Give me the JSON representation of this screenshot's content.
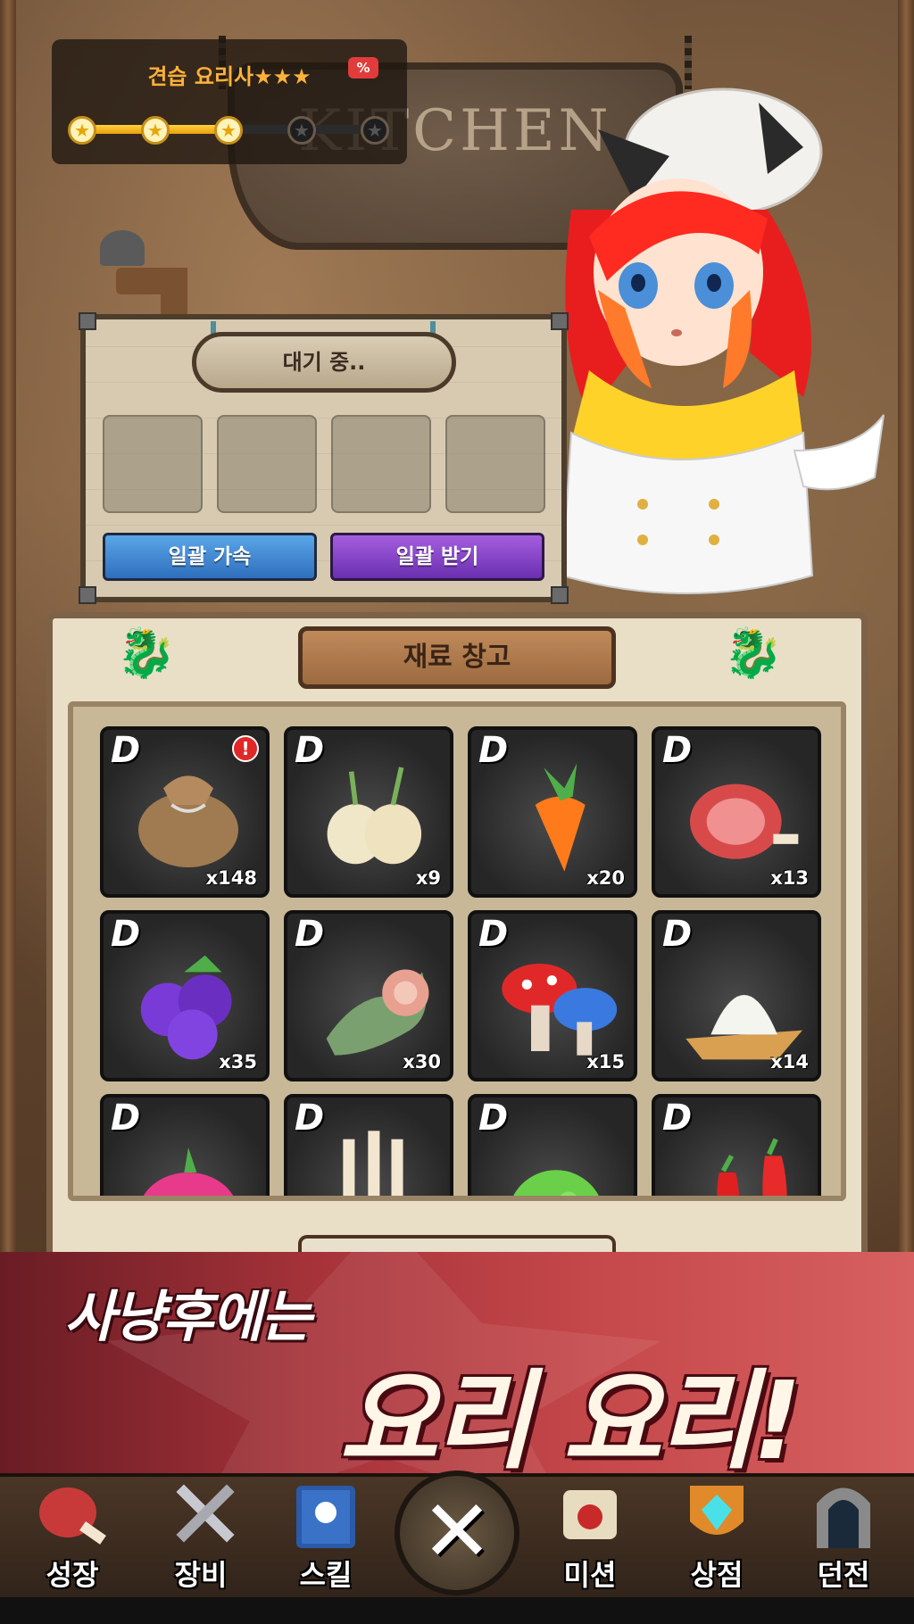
{
  "rank": {
    "title": "견습 요리사★★★",
    "badge": "%",
    "stars_filled": 3,
    "stars_total": 5
  },
  "sign": {
    "text": "KITCHEN"
  },
  "cooking": {
    "status": "대기 중..",
    "slots": 4,
    "speed_up_label": "일괄 가속",
    "receive_all_label": "일괄 받기"
  },
  "warehouse": {
    "title": "재료 창고",
    "items": [
      {
        "grade": "D",
        "name": "grain-sack",
        "count": "x148",
        "alert": "!"
      },
      {
        "grade": "D",
        "name": "onion",
        "count": "x9"
      },
      {
        "grade": "D",
        "name": "carrot",
        "count": "x20"
      },
      {
        "grade": "D",
        "name": "ham-meat",
        "count": "x13"
      },
      {
        "grade": "D",
        "name": "blueberry",
        "count": "x35"
      },
      {
        "grade": "D",
        "name": "worm-meat",
        "count": "x30"
      },
      {
        "grade": "D",
        "name": "mushroom",
        "count": "x15"
      },
      {
        "grade": "D",
        "name": "salt",
        "count": "x14"
      },
      {
        "grade": "D",
        "name": "pink-fruit",
        "count": ""
      },
      {
        "grade": "D",
        "name": "root-meat",
        "count": ""
      },
      {
        "grade": "D",
        "name": "green-fruit",
        "count": ""
      },
      {
        "grade": "D",
        "name": "chili-pepper",
        "count": ""
      }
    ]
  },
  "banner": {
    "line1": "사냥후에는",
    "line2": "요리 요리!"
  },
  "nav": {
    "items": [
      {
        "label": "성장",
        "icon": "meat-icon"
      },
      {
        "label": "장비",
        "icon": "crossed-swords-icon"
      },
      {
        "label": "스킬",
        "icon": "spellbook-icon"
      },
      {
        "label": "미션",
        "icon": "scroll-icon"
      },
      {
        "label": "상점",
        "icon": "diamond-shield-icon"
      },
      {
        "label": "던전",
        "icon": "dungeon-gate-icon"
      }
    ],
    "close_symbol": "✕"
  },
  "colors": {
    "rank_title": "#ffb23a",
    "speed_button": "#2f6fbd",
    "receive_button": "#6a2fb0",
    "banner": "#a7333a"
  }
}
